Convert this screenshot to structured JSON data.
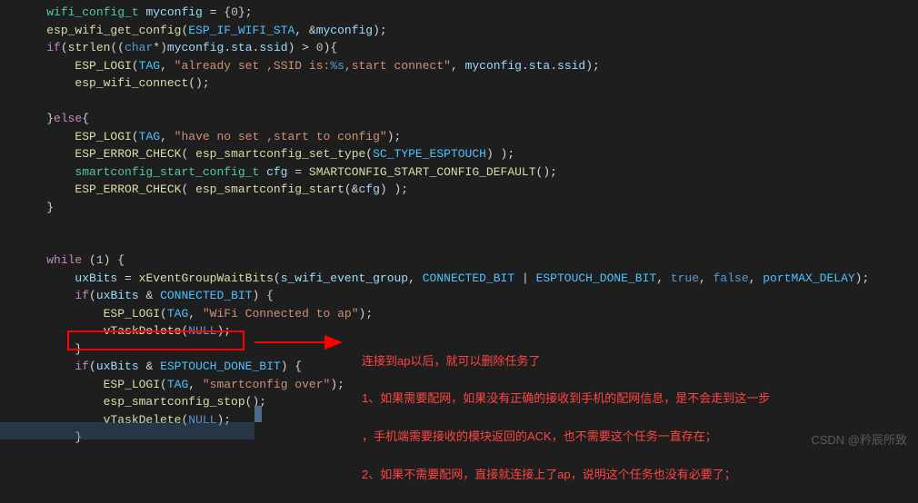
{
  "code": {
    "lines": [
      {
        "indent": 1,
        "tokens": [
          {
            "t": "wifi_config_t",
            "c": "type"
          },
          {
            "t": " ",
            "c": "op"
          },
          {
            "t": "myconfig",
            "c": "var"
          },
          {
            "t": " = {",
            "c": "op"
          },
          {
            "t": "0",
            "c": "num"
          },
          {
            "t": "};",
            "c": "op"
          }
        ]
      },
      {
        "indent": 1,
        "tokens": [
          {
            "t": "esp_wifi_get_config",
            "c": "func"
          },
          {
            "t": "(",
            "c": "paren"
          },
          {
            "t": "ESP_IF_WIFI_STA",
            "c": "const"
          },
          {
            "t": ", &",
            "c": "op"
          },
          {
            "t": "myconfig",
            "c": "var"
          },
          {
            "t": ");",
            "c": "paren"
          }
        ]
      },
      {
        "indent": 1,
        "tokens": [
          {
            "t": "if",
            "c": "keyword"
          },
          {
            "t": "(",
            "c": "paren"
          },
          {
            "t": "strlen",
            "c": "func"
          },
          {
            "t": "((",
            "c": "paren"
          },
          {
            "t": "char",
            "c": "keyword2"
          },
          {
            "t": "*)",
            "c": "op"
          },
          {
            "t": "myconfig",
            "c": "var"
          },
          {
            "t": ".",
            "c": "op"
          },
          {
            "t": "sta",
            "c": "var"
          },
          {
            "t": ".",
            "c": "op"
          },
          {
            "t": "ssid",
            "c": "var"
          },
          {
            "t": ") > ",
            "c": "op"
          },
          {
            "t": "0",
            "c": "num"
          },
          {
            "t": "){",
            "c": "op"
          }
        ]
      },
      {
        "indent": 2,
        "tokens": [
          {
            "t": "ESP_LOGI",
            "c": "func"
          },
          {
            "t": "(",
            "c": "paren"
          },
          {
            "t": "TAG",
            "c": "const"
          },
          {
            "t": ", ",
            "c": "op"
          },
          {
            "t": "\"already set ,SSID is:",
            "c": "string"
          },
          {
            "t": "%s",
            "c": "keyword2"
          },
          {
            "t": ",start connect\"",
            "c": "string"
          },
          {
            "t": ", ",
            "c": "op"
          },
          {
            "t": "myconfig",
            "c": "var"
          },
          {
            "t": ".",
            "c": "op"
          },
          {
            "t": "sta",
            "c": "var"
          },
          {
            "t": ".",
            "c": "op"
          },
          {
            "t": "ssid",
            "c": "var"
          },
          {
            "t": ");",
            "c": "paren"
          }
        ]
      },
      {
        "indent": 2,
        "tokens": [
          {
            "t": "esp_wifi_connect",
            "c": "func"
          },
          {
            "t": "();",
            "c": "paren"
          }
        ]
      },
      {
        "indent": 0,
        "tokens": []
      },
      {
        "indent": 1,
        "tokens": [
          {
            "t": "}",
            "c": "op"
          },
          {
            "t": "else",
            "c": "keyword"
          },
          {
            "t": "{",
            "c": "op"
          }
        ]
      },
      {
        "indent": 2,
        "tokens": [
          {
            "t": "ESP_LOGI",
            "c": "func"
          },
          {
            "t": "(",
            "c": "paren"
          },
          {
            "t": "TAG",
            "c": "const"
          },
          {
            "t": ", ",
            "c": "op"
          },
          {
            "t": "\"have no set ,start to config\"",
            "c": "string"
          },
          {
            "t": ");",
            "c": "paren"
          }
        ]
      },
      {
        "indent": 2,
        "tokens": [
          {
            "t": "ESP_ERROR_CHECK",
            "c": "func"
          },
          {
            "t": "( ",
            "c": "paren"
          },
          {
            "t": "esp_smartconfig_set_type",
            "c": "func"
          },
          {
            "t": "(",
            "c": "paren"
          },
          {
            "t": "SC_TYPE_ESPTOUCH",
            "c": "const"
          },
          {
            "t": ") );",
            "c": "paren"
          }
        ]
      },
      {
        "indent": 2,
        "tokens": [
          {
            "t": "smartconfig_start_config_t",
            "c": "type"
          },
          {
            "t": " ",
            "c": "op"
          },
          {
            "t": "cfg",
            "c": "var"
          },
          {
            "t": " = ",
            "c": "op"
          },
          {
            "t": "SMARTCONFIG_START_CONFIG_DEFAULT",
            "c": "func"
          },
          {
            "t": "();",
            "c": "paren"
          }
        ]
      },
      {
        "indent": 2,
        "tokens": [
          {
            "t": "ESP_ERROR_CHECK",
            "c": "func"
          },
          {
            "t": "( ",
            "c": "paren"
          },
          {
            "t": "esp_smartconfig_start",
            "c": "func"
          },
          {
            "t": "(&",
            "c": "paren"
          },
          {
            "t": "cfg",
            "c": "var"
          },
          {
            "t": ") );",
            "c": "paren"
          }
        ]
      },
      {
        "indent": 1,
        "tokens": [
          {
            "t": "}",
            "c": "op"
          }
        ]
      },
      {
        "indent": 0,
        "tokens": []
      },
      {
        "indent": 0,
        "tokens": []
      },
      {
        "indent": 1,
        "tokens": [
          {
            "t": "while",
            "c": "keyword"
          },
          {
            "t": " (",
            "c": "paren"
          },
          {
            "t": "1",
            "c": "num"
          },
          {
            "t": ") {",
            "c": "paren"
          }
        ]
      },
      {
        "indent": 2,
        "tokens": [
          {
            "t": "uxBits",
            "c": "var"
          },
          {
            "t": " = ",
            "c": "op"
          },
          {
            "t": "xEventGroupWaitBits",
            "c": "func"
          },
          {
            "t": "(",
            "c": "paren"
          },
          {
            "t": "s_wifi_event_group",
            "c": "var"
          },
          {
            "t": ", ",
            "c": "op"
          },
          {
            "t": "CONNECTED_BIT",
            "c": "const"
          },
          {
            "t": " | ",
            "c": "op"
          },
          {
            "t": "ESPTOUCH_DONE_BIT",
            "c": "const"
          },
          {
            "t": ", ",
            "c": "op"
          },
          {
            "t": "true",
            "c": "bool"
          },
          {
            "t": ", ",
            "c": "op"
          },
          {
            "t": "false",
            "c": "bool"
          },
          {
            "t": ", ",
            "c": "op"
          },
          {
            "t": "portMAX_DELAY",
            "c": "const"
          },
          {
            "t": ");",
            "c": "paren"
          }
        ]
      },
      {
        "indent": 2,
        "tokens": [
          {
            "t": "if",
            "c": "keyword"
          },
          {
            "t": "(",
            "c": "paren"
          },
          {
            "t": "uxBits",
            "c": "var"
          },
          {
            "t": " & ",
            "c": "op"
          },
          {
            "t": "CONNECTED_BIT",
            "c": "const"
          },
          {
            "t": ") {",
            "c": "paren"
          }
        ]
      },
      {
        "indent": 3,
        "tokens": [
          {
            "t": "ESP_LOGI",
            "c": "func"
          },
          {
            "t": "(",
            "c": "paren"
          },
          {
            "t": "TAG",
            "c": "const"
          },
          {
            "t": ", ",
            "c": "op"
          },
          {
            "t": "\"WiFi Connected to ap\"",
            "c": "string"
          },
          {
            "t": ");",
            "c": "paren"
          }
        ]
      },
      {
        "indent": 3,
        "tokens": [
          {
            "t": "vTaskDelete",
            "c": "func"
          },
          {
            "t": "(",
            "c": "paren"
          },
          {
            "t": "NULL",
            "c": "macro"
          },
          {
            "t": ");",
            "c": "paren"
          }
        ]
      },
      {
        "indent": 2,
        "tokens": [
          {
            "t": "}",
            "c": "op"
          }
        ]
      },
      {
        "indent": 2,
        "tokens": [
          {
            "t": "if",
            "c": "keyword"
          },
          {
            "t": "(",
            "c": "paren"
          },
          {
            "t": "uxBits",
            "c": "var"
          },
          {
            "t": " & ",
            "c": "op"
          },
          {
            "t": "ESPTOUCH_DONE_BIT",
            "c": "const"
          },
          {
            "t": ") {",
            "c": "paren"
          }
        ]
      },
      {
        "indent": 3,
        "tokens": [
          {
            "t": "ESP_LOGI",
            "c": "func"
          },
          {
            "t": "(",
            "c": "paren"
          },
          {
            "t": "TAG",
            "c": "const"
          },
          {
            "t": ", ",
            "c": "op"
          },
          {
            "t": "\"smartconfig over\"",
            "c": "string"
          },
          {
            "t": ");",
            "c": "paren"
          }
        ]
      },
      {
        "indent": 3,
        "tokens": [
          {
            "t": "esp_smartconfig_stop",
            "c": "func"
          },
          {
            "t": "();",
            "c": "paren"
          }
        ]
      },
      {
        "indent": 3,
        "tokens": [
          {
            "t": "vTaskDelete",
            "c": "func"
          },
          {
            "t": "(",
            "c": "paren"
          },
          {
            "t": "NULL",
            "c": "macro"
          },
          {
            "t": ");",
            "c": "paren"
          }
        ]
      },
      {
        "indent": 2,
        "tokens": [
          {
            "t": "}",
            "c": "op"
          }
        ]
      }
    ]
  },
  "annotation": {
    "line1": "连接到ap以后，就可以删除任务了",
    "line2": "1、如果需要配网，如果没有正确的接收到手机的配网信息，是不会走到这一步",
    "line3": "，手机端需要接收的模块返回的ACK，也不需要这个任务一直存在；",
    "line4": "2、如果不需要配网，直接就连接上了ap，说明这个任务也没有必要了；"
  },
  "watermark": "CSDN @矜辰所致"
}
